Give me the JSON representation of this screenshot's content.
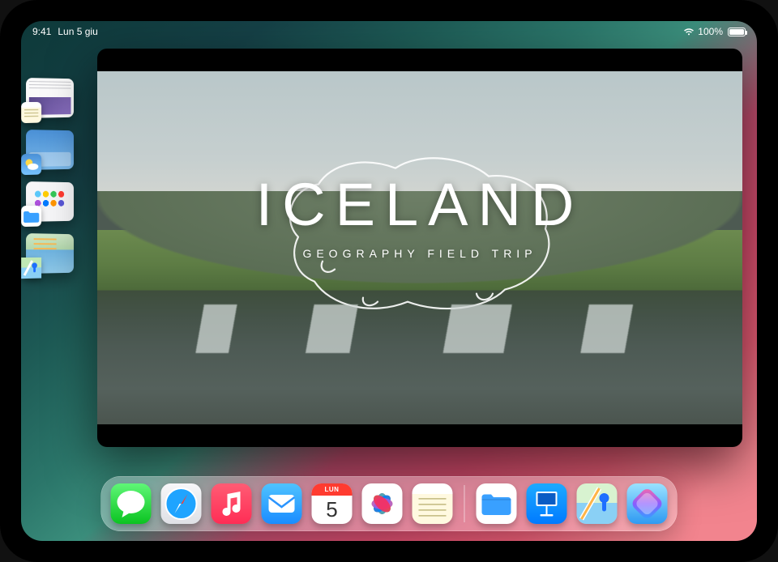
{
  "status": {
    "time": "9:41",
    "date": "Lun 5 giu",
    "battery_pct": "100%"
  },
  "stage_sidebar": {
    "items": [
      {
        "app": "Notes",
        "icon": "notes-icon"
      },
      {
        "app": "Weather",
        "icon": "weather-icon"
      },
      {
        "app": "Files",
        "icon": "files-icon"
      },
      {
        "app": "Maps",
        "icon": "maps-icon"
      }
    ]
  },
  "main_window": {
    "app": "Keynote",
    "slide": {
      "title": "ICELAND",
      "subtitle": "GEOGRAPHY FIELD TRIP"
    }
  },
  "dock": {
    "apps": [
      {
        "name": "Messages",
        "icon": "messages-icon"
      },
      {
        "name": "Safari",
        "icon": "safari-icon"
      },
      {
        "name": "Music",
        "icon": "music-icon"
      },
      {
        "name": "Mail",
        "icon": "mail-icon"
      },
      {
        "name": "Calendar",
        "icon": "calendar-icon",
        "badge_top": "LUN",
        "badge_num": "5"
      },
      {
        "name": "Photos",
        "icon": "photos-icon"
      },
      {
        "name": "Notes",
        "icon": "notes-icon"
      }
    ],
    "recents": [
      {
        "name": "Files",
        "icon": "files-icon"
      },
      {
        "name": "Keynote",
        "icon": "keynote-icon"
      },
      {
        "name": "Maps",
        "icon": "maps-icon"
      },
      {
        "name": "Shortcuts",
        "icon": "shortcuts-icon"
      }
    ]
  }
}
